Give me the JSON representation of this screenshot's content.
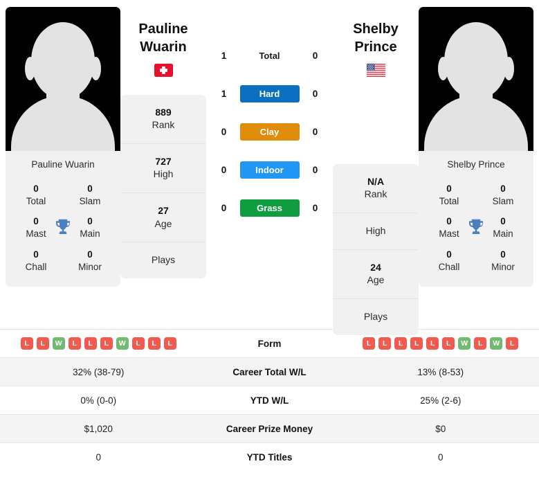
{
  "players": {
    "left": {
      "first_name": "Pauline",
      "last_name": "Wuarin",
      "full_name": "Pauline Wuarin",
      "country": "Switzerland",
      "flag_icon": "flag-switzerland",
      "rank": "889",
      "rank_label": "Rank",
      "high": "727",
      "high_label": "High",
      "age": "27",
      "age_label": "Age",
      "plays_label": "Plays",
      "plays_value": "",
      "titles": [
        {
          "value": "0",
          "label": "Total"
        },
        {
          "value": "0",
          "label": "Slam"
        },
        {
          "value": "0",
          "label": "Mast"
        },
        {
          "value": "0",
          "label": "Main"
        },
        {
          "value": "0",
          "label": "Chall"
        },
        {
          "value": "0",
          "label": "Minor"
        }
      ],
      "surface_scores": {
        "total": "1",
        "hard": "1",
        "clay": "0",
        "indoor": "0",
        "grass": "0"
      },
      "form": [
        "L",
        "L",
        "W",
        "L",
        "L",
        "L",
        "W",
        "L",
        "L",
        "L"
      ],
      "career_total_wl": "32% (38-79)",
      "ytd_wl": "0% (0-0)",
      "career_prize_money": "$1,020",
      "ytd_titles": "0"
    },
    "right": {
      "first_name": "Shelby",
      "last_name": "Prince",
      "full_name": "Shelby Prince",
      "country": "United States",
      "flag_icon": "flag-usa",
      "rank": "N/A",
      "rank_label": "Rank",
      "high": "",
      "high_label": "High",
      "age": "24",
      "age_label": "Age",
      "plays_label": "Plays",
      "plays_value": "",
      "titles": [
        {
          "value": "0",
          "label": "Total"
        },
        {
          "value": "0",
          "label": "Slam"
        },
        {
          "value": "0",
          "label": "Mast"
        },
        {
          "value": "0",
          "label": "Main"
        },
        {
          "value": "0",
          "label": "Chall"
        },
        {
          "value": "0",
          "label": "Minor"
        }
      ],
      "surface_scores": {
        "total": "0",
        "hard": "0",
        "clay": "0",
        "indoor": "0",
        "grass": "0"
      },
      "form": [
        "L",
        "L",
        "L",
        "L",
        "L",
        "L",
        "W",
        "L",
        "W",
        "L"
      ],
      "career_total_wl": "13% (8-53)",
      "ytd_wl": "25% (2-6)",
      "career_prize_money": "$0",
      "ytd_titles": "0"
    }
  },
  "surfaces": [
    {
      "key": "total",
      "label": "Total",
      "color": "transparent"
    },
    {
      "key": "hard",
      "label": "Hard",
      "color": "#0d6fc0"
    },
    {
      "key": "clay",
      "label": "Clay",
      "color": "#e08b0a"
    },
    {
      "key": "indoor",
      "label": "Indoor",
      "color": "#2196f3"
    },
    {
      "key": "grass",
      "label": "Grass",
      "color": "#0f9d3f"
    }
  ],
  "stats_table": {
    "rows": [
      {
        "label": "Form",
        "left": "",
        "right": ""
      },
      {
        "label": "Career Total W/L",
        "left": "32% (38-79)",
        "right": "13% (8-53)"
      },
      {
        "label": "YTD W/L",
        "left": "0% (0-0)",
        "right": "25% (2-6)"
      },
      {
        "label": "Career Prize Money",
        "left": "$1,020",
        "right": "$0"
      },
      {
        "label": "YTD Titles",
        "left": "0",
        "right": "0"
      }
    ]
  },
  "colors": {
    "card_bg": "#f1f1f1",
    "win": "#72b972",
    "loss": "#f05a4f",
    "trophy": "#4a7fc1",
    "row_shade": "#f4f4f4"
  }
}
